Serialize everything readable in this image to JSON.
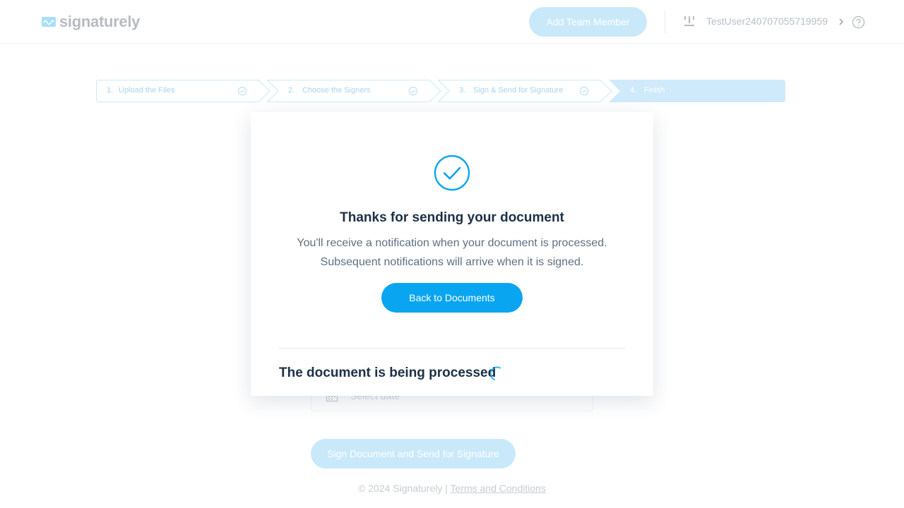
{
  "header": {
    "logo_text": "signaturely",
    "add_team_member_label": "Add Team Member",
    "user_name": "TestUser240707055719959"
  },
  "stepper": {
    "steps": [
      {
        "number": "1.",
        "label": "Upload the Files",
        "completed": true
      },
      {
        "number": "2.",
        "label": "Choose the Signers",
        "completed": true
      },
      {
        "number": "3.",
        "label": "Sign & Send for Signature",
        "completed": true
      },
      {
        "number": "4.",
        "label": "Finish",
        "active": true
      }
    ]
  },
  "form": {
    "date_placeholder": "Select date",
    "sign_button_label": "Sign Document and Send for Signature"
  },
  "footer": {
    "copyright": "© 2024 Signaturely |",
    "terms_label": "Terms and Conditions"
  },
  "modal": {
    "title": "Thanks for sending your document",
    "subtitle_line1": "You'll receive a notification when your document is processed.",
    "subtitle_line2": "Subsequent notifications will arrive when it is signed.",
    "back_button_label": "Back to Documents",
    "processing_text": "The document is being processed"
  },
  "colors": {
    "accent": "#0aa5f0",
    "accent_faded": "#c9e9fb",
    "heading": "#1c3047",
    "body_text": "#5f6f80"
  }
}
